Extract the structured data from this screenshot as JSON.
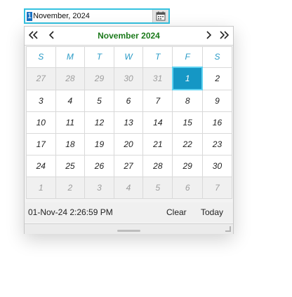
{
  "input": {
    "segment": "1",
    "rest": "November, 2024"
  },
  "calendar": {
    "title": "November 2024",
    "weekdays": [
      "S",
      "M",
      "T",
      "W",
      "T",
      "F",
      "S"
    ],
    "weeks": [
      [
        {
          "d": "27",
          "o": true
        },
        {
          "d": "28",
          "o": true
        },
        {
          "d": "29",
          "o": true
        },
        {
          "d": "30",
          "o": true
        },
        {
          "d": "31",
          "o": true
        },
        {
          "d": "1",
          "s": true
        },
        {
          "d": "2"
        }
      ],
      [
        {
          "d": "3"
        },
        {
          "d": "4"
        },
        {
          "d": "5"
        },
        {
          "d": "6"
        },
        {
          "d": "7"
        },
        {
          "d": "8"
        },
        {
          "d": "9"
        }
      ],
      [
        {
          "d": "10"
        },
        {
          "d": "11"
        },
        {
          "d": "12"
        },
        {
          "d": "13"
        },
        {
          "d": "14"
        },
        {
          "d": "15"
        },
        {
          "d": "16"
        }
      ],
      [
        {
          "d": "17"
        },
        {
          "d": "18"
        },
        {
          "d": "19"
        },
        {
          "d": "20"
        },
        {
          "d": "21"
        },
        {
          "d": "22"
        },
        {
          "d": "23"
        }
      ],
      [
        {
          "d": "24"
        },
        {
          "d": "25"
        },
        {
          "d": "26"
        },
        {
          "d": "27"
        },
        {
          "d": "28"
        },
        {
          "d": "29"
        },
        {
          "d": "30"
        }
      ],
      [
        {
          "d": "1",
          "o": true
        },
        {
          "d": "2",
          "o": true
        },
        {
          "d": "3",
          "o": true
        },
        {
          "d": "4",
          "o": true
        },
        {
          "d": "5",
          "o": true
        },
        {
          "d": "6",
          "o": true
        },
        {
          "d": "7",
          "o": true
        }
      ]
    ]
  },
  "footer": {
    "timestamp": "01-Nov-24 2:26:59 PM",
    "clear_label": "Clear",
    "today_label": "Today"
  },
  "icons": {
    "calendar_button": "calendar-icon",
    "prev_year": "double-chevron-left-icon",
    "prev_month": "chevron-left-icon",
    "next_month": "chevron-right-icon",
    "next_year": "double-chevron-right-icon"
  },
  "colors": {
    "focus_border": "#35c2e0",
    "title_green": "#1b7a1b",
    "weekday_blue": "#2a9bc7",
    "selected_bg": "#1597c5"
  }
}
